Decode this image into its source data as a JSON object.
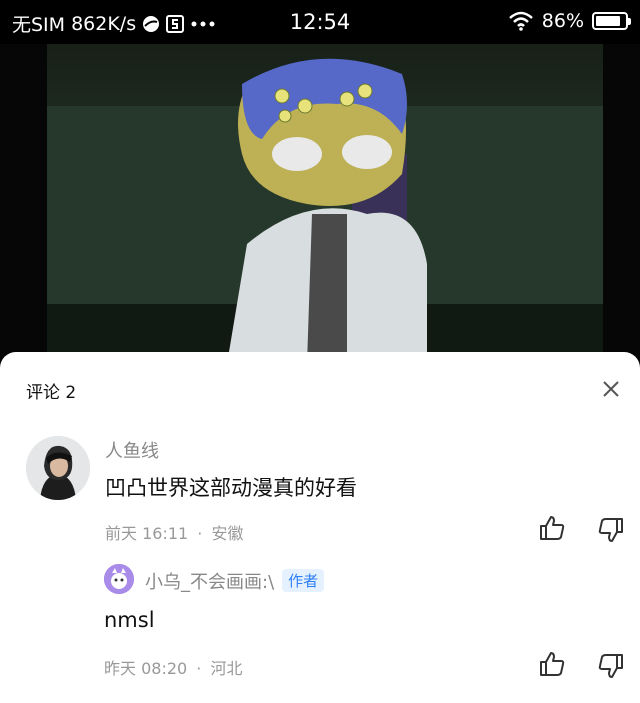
{
  "status_bar": {
    "carrier": "无SIM",
    "speed": "862K/s",
    "time": "12:54",
    "battery": "86%",
    "battery_level": 0.86,
    "icons": [
      "browser-icon",
      "s-app-icon",
      "more-dots-icon",
      "wifi-icon",
      "battery-icon"
    ]
  },
  "video": {
    "frame_colors": {
      "wall": "#26382b",
      "hair": "#5668c8",
      "skin": "#bdb055",
      "coat": "#d8dde0"
    }
  },
  "comments_panel": {
    "title": "评论 2",
    "close_icon": "close-icon",
    "comments": [
      {
        "username": "人鱼线",
        "text": "凹凸世界这部动漫真的好看",
        "time": "前天 16:11",
        "location": "安徽",
        "avatar": "avatar-user-photo"
      }
    ],
    "reply": {
      "username": "小乌_不会画画:\\",
      "badge": "作者",
      "text": "nmsl",
      "time": "昨天 08:20",
      "location": "河北",
      "avatar": "avatar-cartoon"
    },
    "meta_separator": "·",
    "accent_color": "#2f7ff5"
  }
}
